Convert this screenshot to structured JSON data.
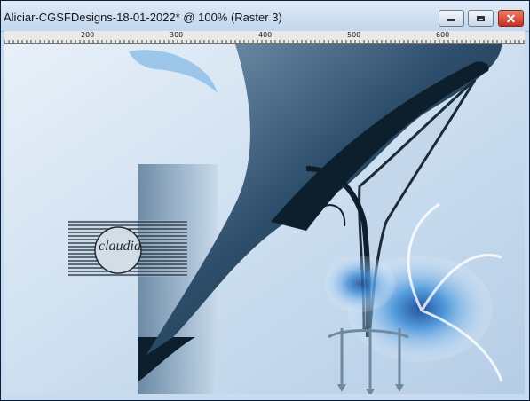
{
  "window": {
    "title": "Aliciar-CGSFDesigns-18-01-2022* @ 100% (Raster 3)",
    "controls": {
      "minimize": "minimize",
      "maximize": "maximize",
      "close": "close"
    }
  },
  "ruler": {
    "labels": [
      "200",
      "300",
      "400",
      "500",
      "600"
    ]
  },
  "canvas": {
    "watermark_text": "claudia",
    "colors": {
      "background": "#d4e3f2",
      "shoe_dark": "#0d1f2c",
      "shoe_mid": "#3c5f7e",
      "flower": "#3d8fd9"
    }
  }
}
